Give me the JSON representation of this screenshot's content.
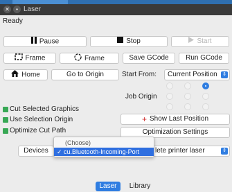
{
  "window": {
    "title": "Laser",
    "status": "Ready"
  },
  "toolbar": {
    "pause": "Pause",
    "stop": "Stop",
    "start": "Start",
    "frame_square": "Frame",
    "frame_circle": "Frame",
    "save_gcode": "Save GCode",
    "run_gcode": "Run GCode",
    "home": "Home",
    "go_to_origin": "Go to Origin"
  },
  "start_from": {
    "label": "Start From:",
    "value": "Current Position"
  },
  "job_origin": {
    "label": "Job Origin",
    "selected_index": 5
  },
  "options": [
    {
      "label": "Cut Selected Graphics",
      "checked": true
    },
    {
      "label": "Use Selection Origin",
      "checked": true
    },
    {
      "label": "Optimize Cut Path",
      "checked": true
    }
  ],
  "show_last_position": "Show Last Position",
  "optimization_settings": "Optimization Settings",
  "devices": {
    "label": "Devices",
    "selected_suffix": "lete printer laser",
    "dropdown_options": [
      "(Choose)",
      "✓ cu.Bluetooth-Incoming-Port"
    ]
  },
  "tabs": [
    "Laser",
    "Library"
  ],
  "colors": {
    "accent": "#2f7de1",
    "check": "#38a855",
    "titlebar": "#3a3a3a"
  }
}
